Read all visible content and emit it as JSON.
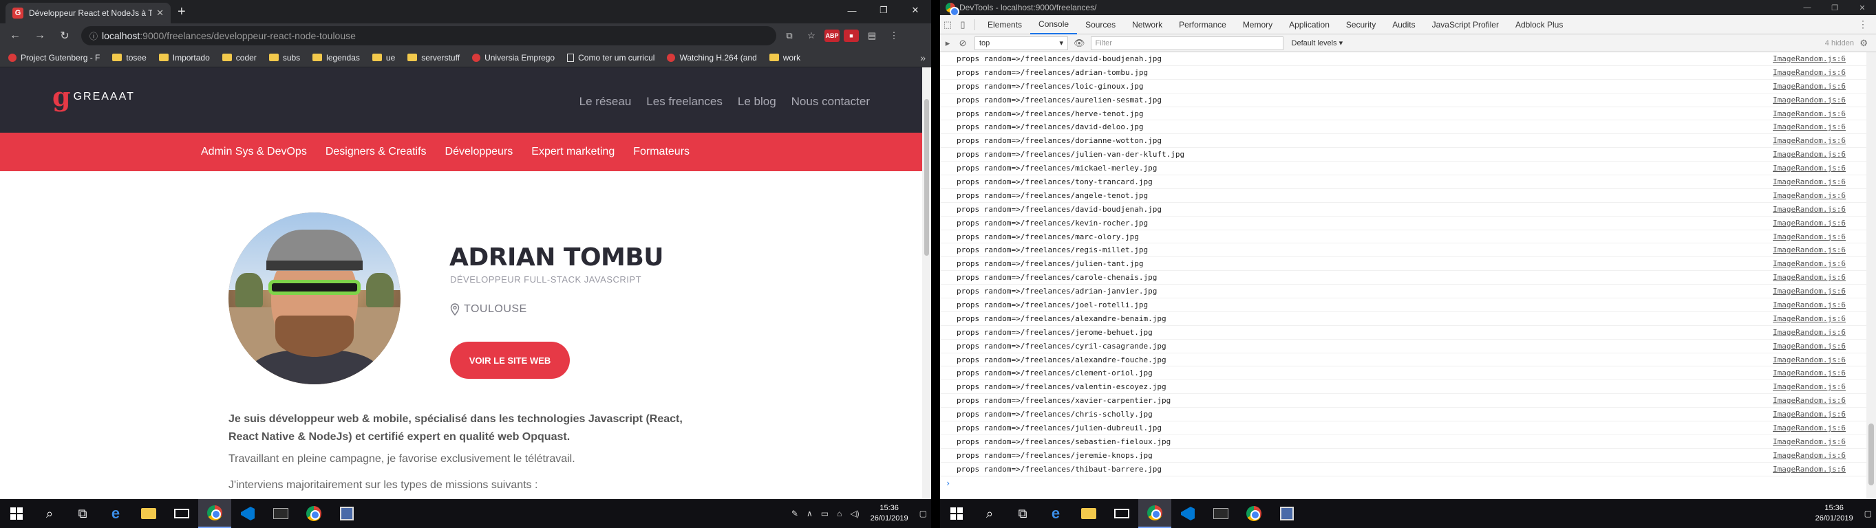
{
  "left": {
    "tab": {
      "title": "Développeur React et NodeJs à Toulouse",
      "favicon": "G",
      "close": "✕"
    },
    "window_controls": [
      "—",
      "❐",
      "✕"
    ],
    "url": {
      "host": "localhost",
      "path": ":9000/freelances/developpeur-react-node-toulouse"
    },
    "ext_abp": "ABP",
    "bookmarks": [
      {
        "label": "Project Gutenberg - F",
        "icon": "red"
      },
      {
        "label": "tosee",
        "icon": "folder"
      },
      {
        "label": "Importado",
        "icon": "folder"
      },
      {
        "label": "coder",
        "icon": "folder"
      },
      {
        "label": "subs",
        "icon": "folder"
      },
      {
        "label": "legendas",
        "icon": "folder"
      },
      {
        "label": "ue",
        "icon": "folder"
      },
      {
        "label": "serverstuff",
        "icon": "folder"
      },
      {
        "label": "Universia Emprego",
        "icon": "red"
      },
      {
        "label": "Como ter um curricul",
        "icon": "page"
      },
      {
        "label": "Watching H.264 (and",
        "icon": "red"
      },
      {
        "label": "work",
        "icon": "folder"
      }
    ],
    "site": {
      "logo": "GREAAAT",
      "logo_mark": "g",
      "topnav": [
        "Le réseau",
        "Les freelances",
        "Le blog",
        "Nous contacter"
      ],
      "categories": [
        "Admin Sys & DevOps",
        "Designers & Creatifs",
        "Développeurs",
        "Expert marketing",
        "Formateurs"
      ],
      "name": "ADRIAN TOMBU",
      "role": "DÉVELOPPEUR FULL-STACK JAVASCRIPT",
      "location": "TOULOUSE",
      "cta": "VOIR LE SITE WEB",
      "bio1": "Je suis développeur web & mobile, spécialisé dans les technologies Javascript (React, React Native & NodeJs) et certifié expert en qualité web Opquast.",
      "bio2": "Travaillant en pleine campagne, je favorise exclusivement le télétravail.",
      "bio3": "J'interviens majoritairement sur les types de missions suivants :"
    },
    "clock": {
      "time": "15:36",
      "date": "26/01/2019"
    }
  },
  "right": {
    "title": "DevTools - localhost:9000/freelances/",
    "tabs": [
      "Elements",
      "Console",
      "Sources",
      "Network",
      "Performance",
      "Memory",
      "Application",
      "Security",
      "Audits",
      "JavaScript Profiler",
      "Adblock Plus"
    ],
    "active_tab": "Console",
    "context": "top",
    "filter_placeholder": "Filter",
    "levels": "Default levels ▾",
    "hidden": "4 hidden",
    "log_prefix": "props random=>",
    "source": "ImageRandom.js:6",
    "logs": [
      "/freelances/david-boudjenah.jpg",
      "/freelances/adrian-tombu.jpg",
      "/freelances/loic-ginoux.jpg",
      "/freelances/aurelien-sesmat.jpg",
      "/freelances/herve-tenot.jpg",
      "/freelances/david-deloo.jpg",
      "/freelances/dorianne-wotton.jpg",
      "/freelances/julien-van-der-kluft.jpg",
      "/freelances/mickael-merley.jpg",
      "/freelances/tony-trancard.jpg",
      "/freelances/angele-tenot.jpg",
      "/freelances/david-boudjenah.jpg",
      "/freelances/kevin-rocher.jpg",
      "/freelances/marc-olory.jpg",
      "/freelances/regis-millet.jpg",
      "/freelances/julien-tant.jpg",
      "/freelances/carole-chenais.jpg",
      "/freelances/adrian-janvier.jpg",
      "/freelances/joel-rotelli.jpg",
      "/freelances/alexandre-benaim.jpg",
      "/freelances/jerome-behuet.jpg",
      "/freelances/cyril-casagrande.jpg",
      "/freelances/alexandre-fouche.jpg",
      "/freelances/clement-oriol.jpg",
      "/freelances/valentin-escoyez.jpg",
      "/freelances/xavier-carpentier.jpg",
      "/freelances/chris-scholly.jpg",
      "/freelances/julien-dubreuil.jpg",
      "/freelances/sebastien-fieloux.jpg",
      "/freelances/jeremie-knops.jpg",
      "/freelances/thibaut-barrere.jpg"
    ],
    "prompt": "›",
    "clock": {
      "time": "15:36",
      "date": "26/01/2019"
    }
  },
  "colors": {
    "brand": "#e63946",
    "header": "#2a2a34"
  }
}
